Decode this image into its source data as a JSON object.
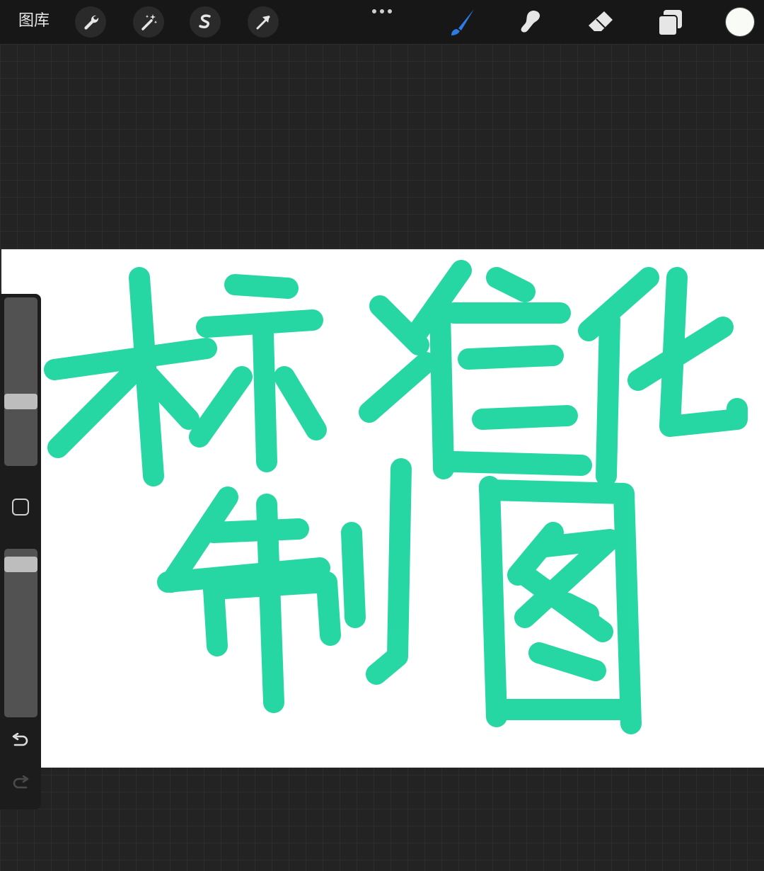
{
  "toolbar": {
    "gallery_label": "图库",
    "left_icons": [
      "wrench-icon",
      "magic-wand-icon",
      "selection-s-icon",
      "arrow-transform-icon"
    ],
    "right_icons": [
      "brush-icon",
      "smudge-icon",
      "eraser-icon",
      "layers-icon"
    ],
    "more_icon": "more-dots-icon",
    "active_tool": "brush-icon",
    "active_color": "#1ed6a0",
    "swatch_color": "#f9fbf7",
    "brush_accent": "#2d7be5"
  },
  "canvas": {
    "background": "#ffffff",
    "stroke_color": "#1ed6a0",
    "handwritten_lines": [
      "标准化",
      "制图"
    ]
  },
  "sidebar": {
    "brush_size_level": 0.37,
    "opacity_level": 0.95,
    "undo_icon": "undo-icon",
    "redo_icon": "redo-icon",
    "modify_icon": "square-modify-icon"
  }
}
